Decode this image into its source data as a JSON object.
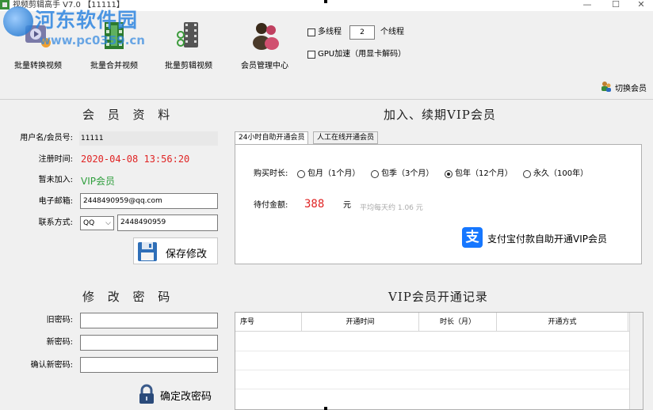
{
  "window": {
    "title": "视频剪辑高手 V7.0 【11111】",
    "minimize_glyph": "—",
    "maximize_glyph": "☐",
    "close_glyph": "✕"
  },
  "watermark": {
    "site_name": "河东软件园",
    "url": "www.pc0359.cn"
  },
  "toolbar": {
    "items": [
      {
        "label": "批量转换视频",
        "icon": "video-convert-icon"
      },
      {
        "label": "批量合并视频",
        "icon": "film-merge-icon"
      },
      {
        "label": "批量剪辑视频",
        "icon": "film-scissors-icon"
      },
      {
        "label": "会员管理中心",
        "icon": "members-icon"
      }
    ],
    "multithread_label": "多线程",
    "thread_count": "2",
    "thread_unit": "个线程",
    "gpu_label": "GPU加速（用显卡解码）",
    "multithread_checked": false,
    "gpu_checked": false
  },
  "switch_member": {
    "label": "切换会员",
    "icon": "switch-user-icon"
  },
  "member_info": {
    "title": "会 员 资 料",
    "username_label": "用户名/会员号:",
    "username_value": "11111",
    "register_label": "注册时间:",
    "register_value": "2020-04-08 13:56:20",
    "join_label": "暂未加入:",
    "join_value": "VIP会员",
    "email_label": "电子邮箱:",
    "email_value": "2448490959@qq.com",
    "contact_label": "联系方式:",
    "contact_type": "QQ",
    "contact_value": "2448490959",
    "save_label": "保存修改"
  },
  "password": {
    "title": "修 改 密 码",
    "old_label": "旧密码:",
    "new_label": "新密码:",
    "confirm_label": "确认新密码:",
    "confirm_button": "确定改密码"
  },
  "vip": {
    "title": "加入、续期VIP会员",
    "tabs": [
      "24小时自助开通会员",
      "人工在线开通会员"
    ],
    "active_tab": 0,
    "duration_label": "购买时长:",
    "options": [
      "包月（1个月）",
      "包季（3个月）",
      "包年（12个月）",
      "永久（100年）"
    ],
    "selected_option": 2,
    "amount_label": "待付金额:",
    "amount_value": "388",
    "amount_unit": "元",
    "daily_note": "平均每天约 1.06 元",
    "alipay_label": "支付宝付款自助开通VIP会员",
    "alipay_glyph": "支"
  },
  "records": {
    "title": "VIP会员开通记录",
    "columns": [
      "序号",
      "开通时间",
      "时长（月）",
      "开通方式"
    ],
    "rows": []
  },
  "colors": {
    "accent_red": "#e02424",
    "vip_green": "#2e9e3c",
    "alipay_blue": "#1677ff",
    "watermark_blue": "#2f86e0"
  }
}
